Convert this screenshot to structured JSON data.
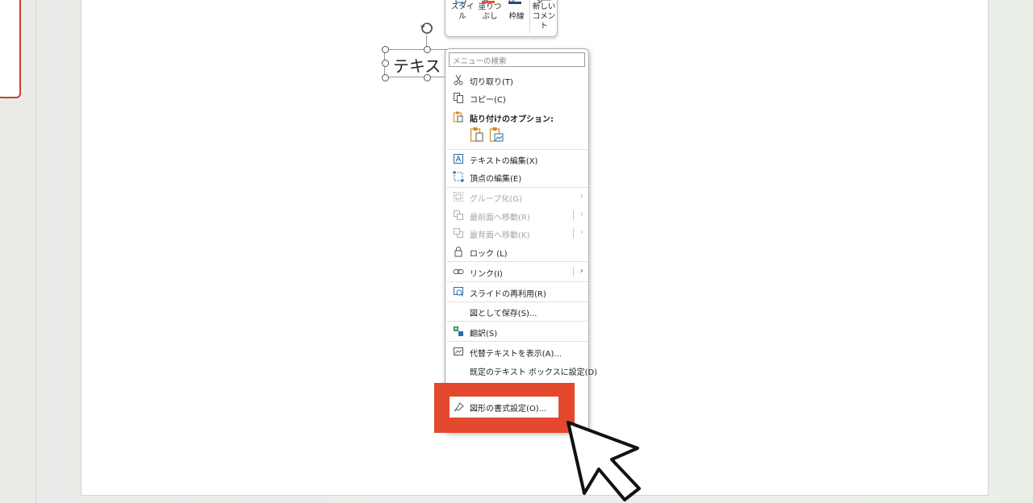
{
  "slide": {
    "textbox_text": "テキス"
  },
  "mini_toolbar": {
    "style_label_1": "スタイ",
    "style_label_2": "ル",
    "fill_label_1": "塗りつ",
    "fill_label_2": "ぶし",
    "outline_label": "枠線",
    "new_comment_label_1": "新しい",
    "new_comment_label_2": "コメント",
    "fill_color": "#e2572b",
    "outline_color": "#1f4e79"
  },
  "context_menu": {
    "search_placeholder": "メニューの検索",
    "items": [
      {
        "label": "切り取り(T)",
        "icon": "scissors-icon"
      },
      {
        "label": "コピー(C)",
        "icon": "copy-icon"
      },
      {
        "label": "貼り付けのオプション:",
        "icon": "paste-icon"
      },
      {
        "label": "テキストの編集(X)",
        "icon": "edit-text-icon"
      },
      {
        "label": "頂点の編集(E)",
        "icon": "edit-points-icon"
      },
      {
        "label": "グループ化(G)",
        "icon": "group-icon"
      },
      {
        "label": "最前面へ移動(R)",
        "icon": "bring-to-front-icon"
      },
      {
        "label": "最背面へ移動(K)",
        "icon": "send-to-back-icon"
      },
      {
        "label": "ロック (L)",
        "icon": "lock-icon"
      },
      {
        "label": "リンク(I)",
        "icon": "link-icon"
      },
      {
        "label": "スライドの再利用(R)",
        "icon": "reuse-slides-icon"
      },
      {
        "label": "図として保存(S)...",
        "icon": ""
      },
      {
        "label": "翻訳(S)",
        "icon": "translate-icon"
      },
      {
        "label": "代替テキストを表示(A)...",
        "icon": "alt-text-icon"
      },
      {
        "label": "既定のテキスト ボックスに設定(D)",
        "icon": ""
      },
      {
        "label": "図形の書式設定(O)...",
        "icon": "format-shape-icon"
      }
    ]
  },
  "colors": {
    "highlight": "#e4492f",
    "thumbnail_border": "#c2452d",
    "icon_blue": "#2e6da4",
    "icon_orange": "#d08a1e"
  }
}
